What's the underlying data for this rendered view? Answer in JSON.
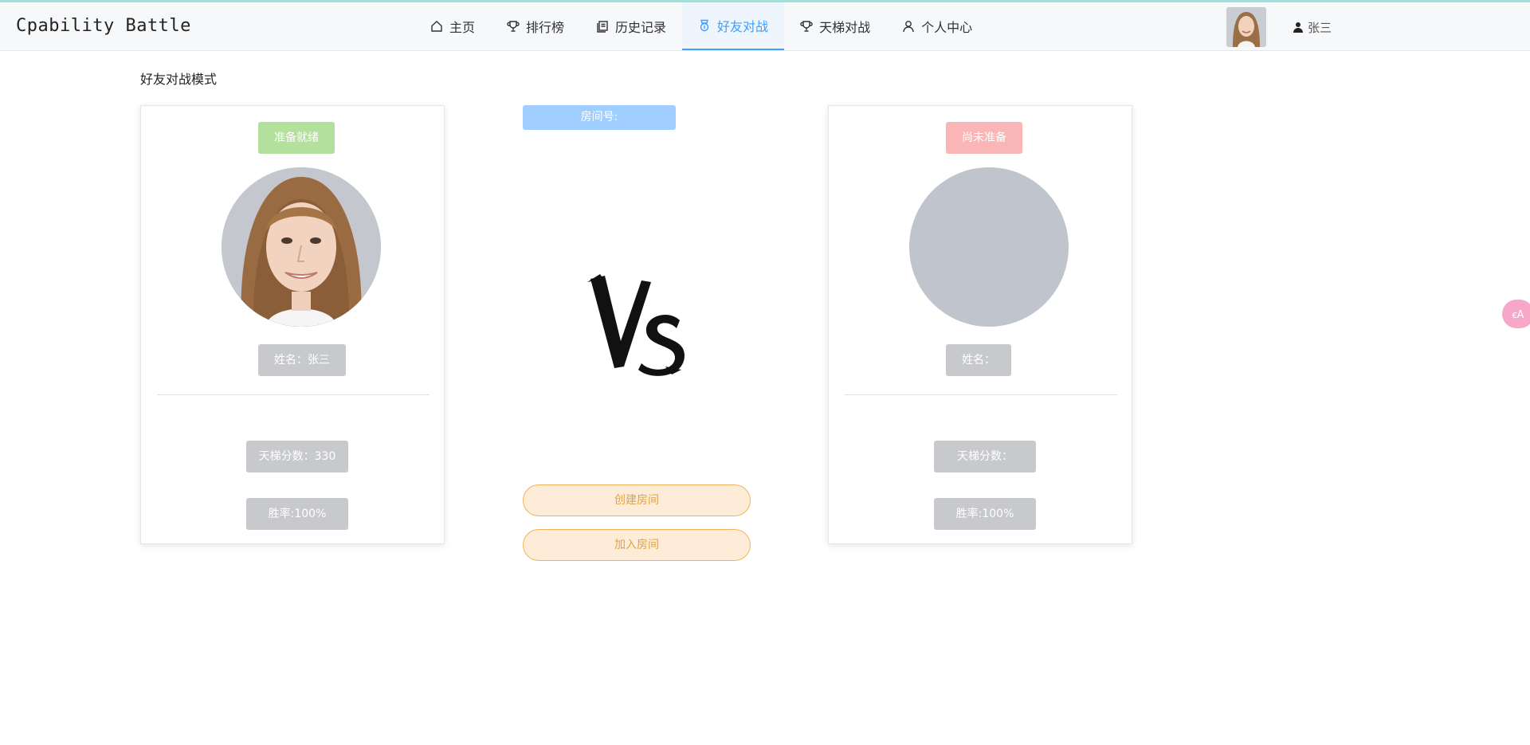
{
  "app": {
    "brand": "Cpability Battle"
  },
  "nav": {
    "items": [
      {
        "label": "主页",
        "icon": "home-icon"
      },
      {
        "label": "排行榜",
        "icon": "trophy-icon"
      },
      {
        "label": "历史记录",
        "icon": "history-icon"
      },
      {
        "label": "好友对战",
        "icon": "medal-icon",
        "active": true
      },
      {
        "label": "天梯对战",
        "icon": "trophy-icon"
      },
      {
        "label": "个人中心",
        "icon": "user-icon"
      }
    ],
    "user_name": "张三",
    "active_color": "#409eff"
  },
  "page": {
    "mode_title": "好友对战模式",
    "room_label": "房间号:",
    "create_room": "创建房间",
    "join_room": "加入房间",
    "vs_text": "VS"
  },
  "player_left": {
    "status": "准备就绪",
    "name": "姓名：张三",
    "ladder_score": "天梯分数：330",
    "win_rate": "胜率:100%"
  },
  "player_right": {
    "status": "尚未准备",
    "name": "姓名：",
    "ladder_score": "天梯分数：",
    "win_rate": "胜率:100%"
  },
  "colors": {
    "ready": "#b3e09c",
    "not_ready": "#fab6b6",
    "info_tag": "#c8c9cc",
    "room_badge": "#a0cfff",
    "orange_button": "#fdecd8"
  },
  "translate_fab": {
    "label": "ꞓA",
    "icon": "translate-icon"
  }
}
